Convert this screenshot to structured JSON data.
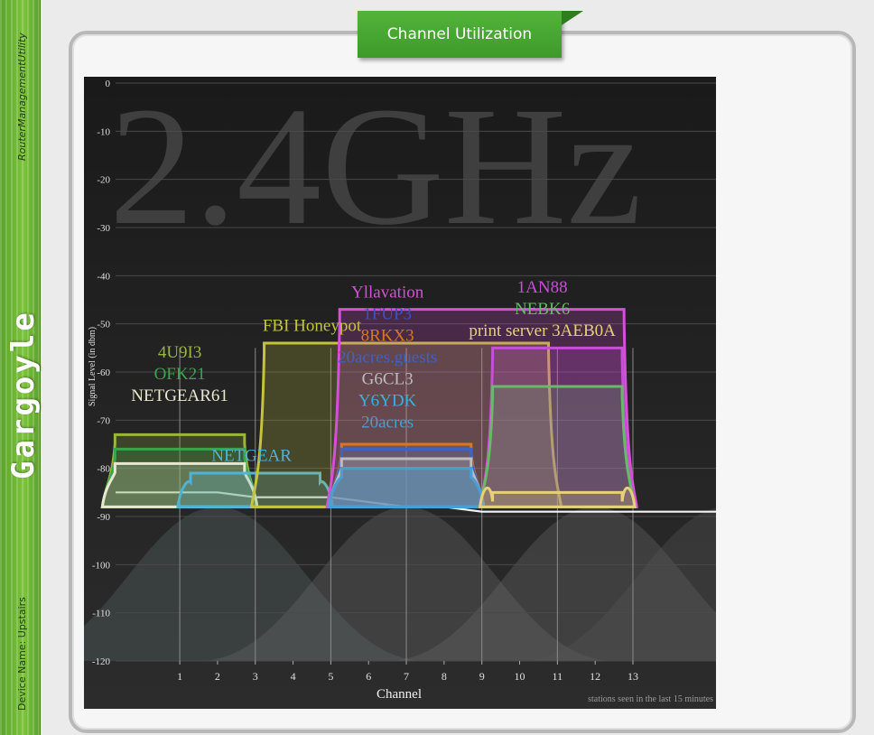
{
  "sidebar": {
    "utility_label": "RouterManagementUtility",
    "brand": "Gargoyle",
    "device_label": "Device Name: Upstairs"
  },
  "header": {
    "title": "Channel Utilization"
  },
  "chart_data": {
    "type": "area",
    "band_watermark": "2.4GHz",
    "xlabel": "Channel",
    "ylabel": "Signal Level (in dbm)",
    "footnote": "stations seen in the last 15 minutes",
    "x_ticks": [
      1,
      2,
      3,
      4,
      5,
      6,
      7,
      8,
      9,
      10,
      11,
      12,
      13
    ],
    "y_ticks": [
      0,
      -10,
      -20,
      -30,
      -40,
      -50,
      -60,
      -70,
      -80,
      -90,
      -100,
      -110,
      -120
    ],
    "xlim": [
      -0.7,
      15.2
    ],
    "ylim": [
      -120,
      0
    ],
    "noise_floor": [
      [
        -0.7,
        -85
      ],
      [
        2,
        -85
      ],
      [
        3,
        -86
      ],
      [
        5,
        -86
      ],
      [
        6,
        -87
      ],
      [
        7,
        -88
      ],
      [
        8,
        -88
      ],
      [
        9,
        -89
      ],
      [
        15.2,
        -89
      ]
    ],
    "networks": [
      {
        "ssid": "4U9I3",
        "channel": 1,
        "width": 20,
        "signal": -73,
        "color": "#9ab63c"
      },
      {
        "ssid": "OFK21",
        "channel": 1,
        "width": 20,
        "signal": -76,
        "color": "#3aa64c"
      },
      {
        "ssid": "NETGEAR61",
        "channel": 1,
        "width": 20,
        "signal": -79,
        "color": "#e8e8d0"
      },
      {
        "ssid": "NETGEAR",
        "channel": 3,
        "width": 20,
        "signal": -81,
        "color": "#4fb3d6"
      },
      {
        "ssid": "FBI Honeypot",
        "channel": 5,
        "width": 40,
        "signal": -54,
        "color": "#c6c43a"
      },
      {
        "ssid": "Yllavation",
        "channel": 7,
        "width": 40,
        "signal": -47,
        "color": "#d64fd8"
      },
      {
        "ssid": "1FUP3",
        "channel": 7,
        "width": 20,
        "signal": -75,
        "color": "#3c50c8"
      },
      {
        "ssid": "8RKX3",
        "channel": 7,
        "width": 20,
        "signal": -75,
        "color": "#d8781c"
      },
      {
        "ssid": "20acres.guests",
        "channel": 7,
        "width": 20,
        "signal": -76,
        "color": "#3c64c0"
      },
      {
        "ssid": "G6CL3",
        "channel": 7,
        "width": 20,
        "signal": -78,
        "color": "#bdbdbd"
      },
      {
        "ssid": "Y6YDK",
        "channel": 7,
        "width": 20,
        "signal": -80,
        "color": "#38b0e0"
      },
      {
        "ssid": "20acres",
        "channel": 7,
        "width": 20,
        "signal": -80,
        "color": "#4a9ed0"
      },
      {
        "ssid": "1AN88",
        "channel": 11,
        "width": 20,
        "signal": -55,
        "color": "#c84fd8"
      },
      {
        "ssid": "NEBK6",
        "channel": 11,
        "width": 20,
        "signal": -63,
        "color": "#6ab86a"
      },
      {
        "ssid": "print server 3AEB0A",
        "channel": 11,
        "width": 20,
        "signal": -85,
        "color": "#e6d07a"
      }
    ],
    "labels": [
      {
        "text": "4U9I3",
        "network": 0,
        "x": 1,
        "y": -57
      },
      {
        "text": "OFK21",
        "network": 1,
        "x": 1,
        "y": -61.5
      },
      {
        "text": "NETGEAR61",
        "network": 2,
        "x": 1,
        "y": -66
      },
      {
        "text": "NETGEAR",
        "network": 3,
        "x": 2.9,
        "y": -78.5
      },
      {
        "text": "FBI Honeypot",
        "network": 4,
        "x": 4.5,
        "y": -51.5
      },
      {
        "text": "Yllavation",
        "network": 5,
        "x": 6.5,
        "y": -44.5
      },
      {
        "text": "1FUP3",
        "network": 6,
        "x": 6.5,
        "y": -49
      },
      {
        "text": "8RKX3",
        "network": 7,
        "x": 6.5,
        "y": -53.5
      },
      {
        "text": "20acres.guests",
        "network": 8,
        "x": 6.5,
        "y": -58
      },
      {
        "text": "G6CL3",
        "network": 9,
        "x": 6.5,
        "y": -62.5
      },
      {
        "text": "Y6YDK",
        "network": 10,
        "x": 6.5,
        "y": -67
      },
      {
        "text": "20acres",
        "network": 11,
        "x": 6.5,
        "y": -71.5
      },
      {
        "text": "1AN88",
        "network": 12,
        "x": 10.6,
        "y": -43.5
      },
      {
        "text": "NEBK6",
        "network": 13,
        "x": 10.6,
        "y": -48
      },
      {
        "text": "print server 3AEB0A",
        "network": 14,
        "x": 10.6,
        "y": -52.5
      }
    ]
  }
}
